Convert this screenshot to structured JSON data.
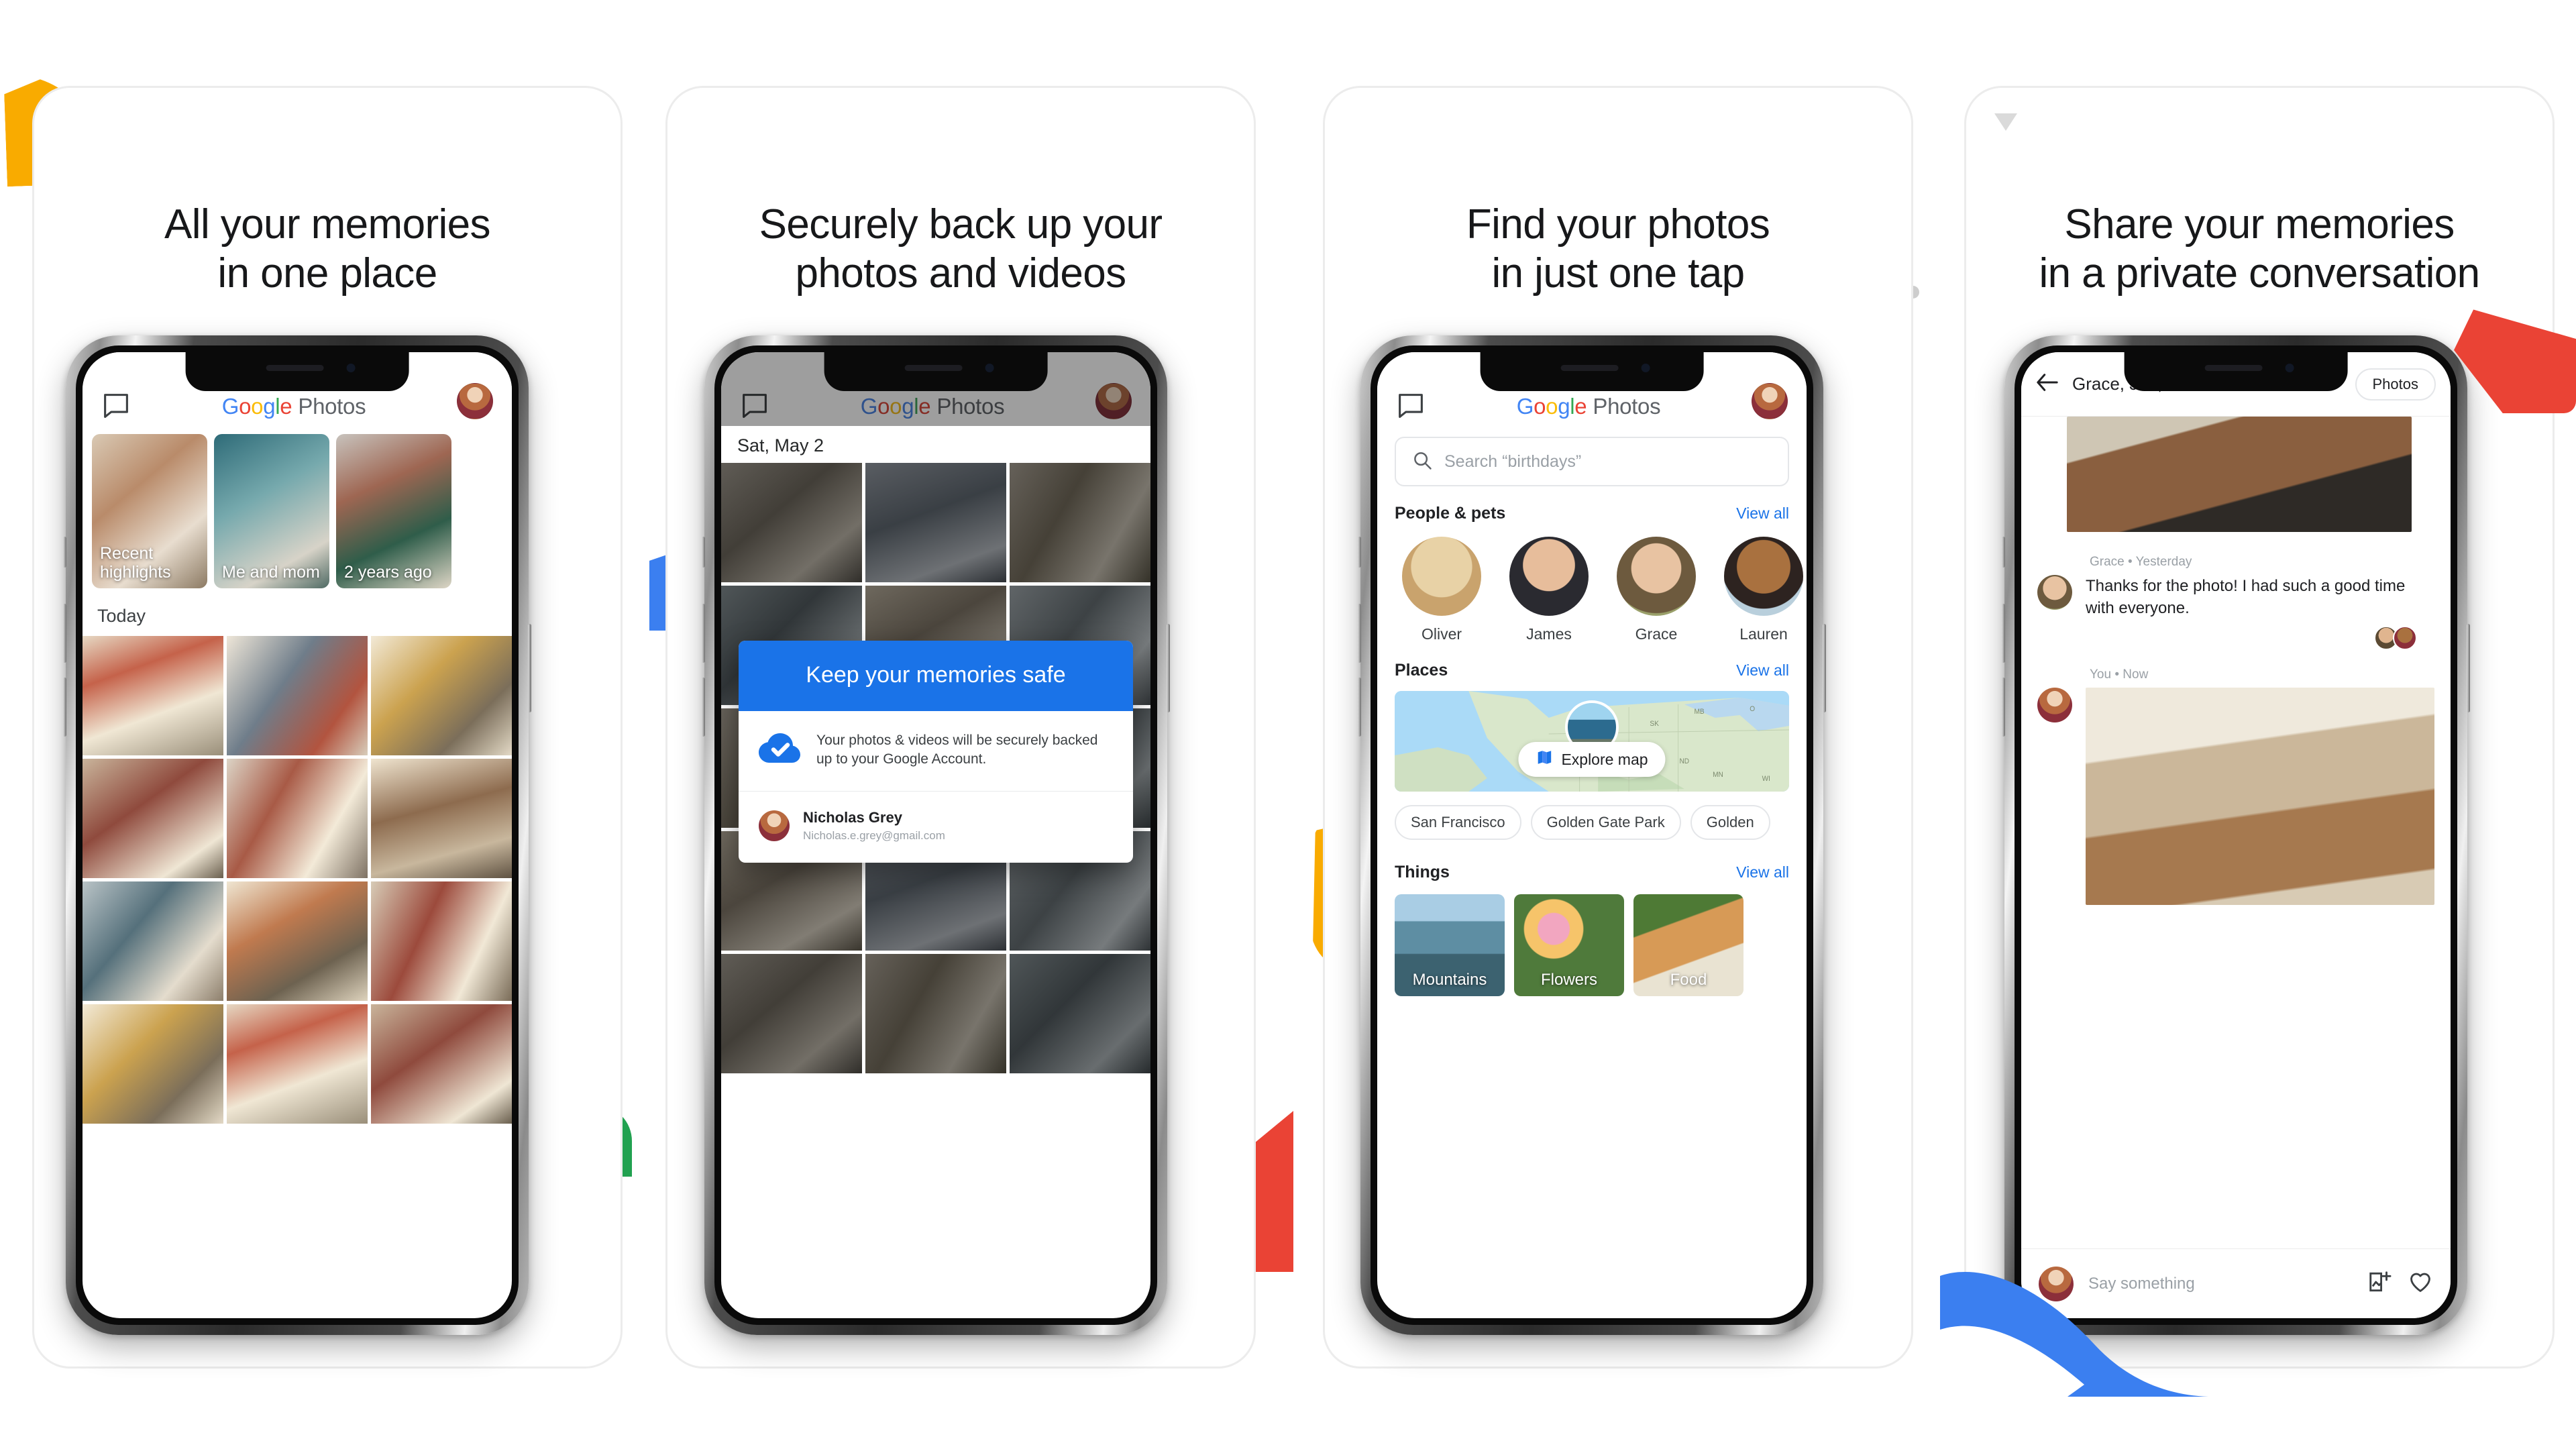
{
  "cards": [
    {
      "id": "card-1",
      "headline_line1": "All your memories",
      "headline_line2": "in one place",
      "app": {
        "brand_google": "Google",
        "brand_photos": "Photos",
        "chat_icon": "chat-bubble-icon",
        "avatar_icon": "user-avatar",
        "highlights": [
          {
            "label": "Recent highlights"
          },
          {
            "label": "Me and mom"
          },
          {
            "label": "2 years ago"
          }
        ],
        "section_today": "Today"
      }
    },
    {
      "id": "card-2",
      "headline_line1": "Securely back up your",
      "headline_line2": "photos and videos",
      "app": {
        "brand_google": "Google",
        "brand_photos": "Photos",
        "date_label": "Sat, May 2",
        "dialog": {
          "title": "Keep your memories safe",
          "icon": "cloud-check-icon",
          "body": "Your photos & videos will be securely backed up to your Google Account.",
          "account_name": "Nicholas Grey",
          "account_email": "Nicholas.e.grey@gmail.com"
        }
      }
    },
    {
      "id": "card-3",
      "headline_line1": "Find your photos",
      "headline_line2": "in just one tap",
      "app": {
        "brand_google": "Google",
        "brand_photos": "Photos",
        "search_placeholder": "Search “birthdays”",
        "search_icon": "search-icon",
        "sections": {
          "people": {
            "title": "People & pets",
            "view_all": "View all"
          },
          "places": {
            "title": "Places",
            "view_all": "View all"
          },
          "things": {
            "title": "Things",
            "view_all": "View all"
          }
        },
        "people": [
          {
            "name": "Oliver"
          },
          {
            "name": "James"
          },
          {
            "name": "Grace"
          },
          {
            "name": "Lauren"
          }
        ],
        "explore_map": "Explore map",
        "map_icon": "map-icon",
        "place_chips": [
          "San Francisco",
          "Golden Gate Park",
          "Golden"
        ],
        "things": [
          {
            "label": "Mountains"
          },
          {
            "label": "Flowers"
          },
          {
            "label": "Food"
          }
        ]
      }
    },
    {
      "id": "card-4",
      "headline_line1": "Share your memories",
      "headline_line2": "in a private conversation",
      "app": {
        "back_icon": "back-arrow-icon",
        "conversation_title": "Grace, Jen, Nick",
        "chevron_icon": "chevron-right-icon",
        "photos_pill": "Photos",
        "messages": [
          {
            "author": "Grace",
            "time": "Yesterday",
            "separator": "•",
            "text": "Thanks for the photo! I had such a good time with everyone."
          },
          {
            "author": "You",
            "time": "Now",
            "separator": "•",
            "text": ""
          }
        ],
        "compose_placeholder": "Say something",
        "add_photo_icon": "add-photo-icon",
        "heart_icon": "heart-icon"
      }
    }
  ],
  "colors": {
    "google_blue": "#4285F4",
    "google_red": "#EA4335",
    "google_yellow": "#FBBC05",
    "google_green": "#34A853",
    "dialog_blue": "#1a73e8",
    "link_blue": "#1a73e8",
    "accent_yellow": "#F9AB00",
    "accent_red": "#EA4335",
    "accent_green": "#21A150",
    "accent_blue": "#3B7FF0"
  }
}
